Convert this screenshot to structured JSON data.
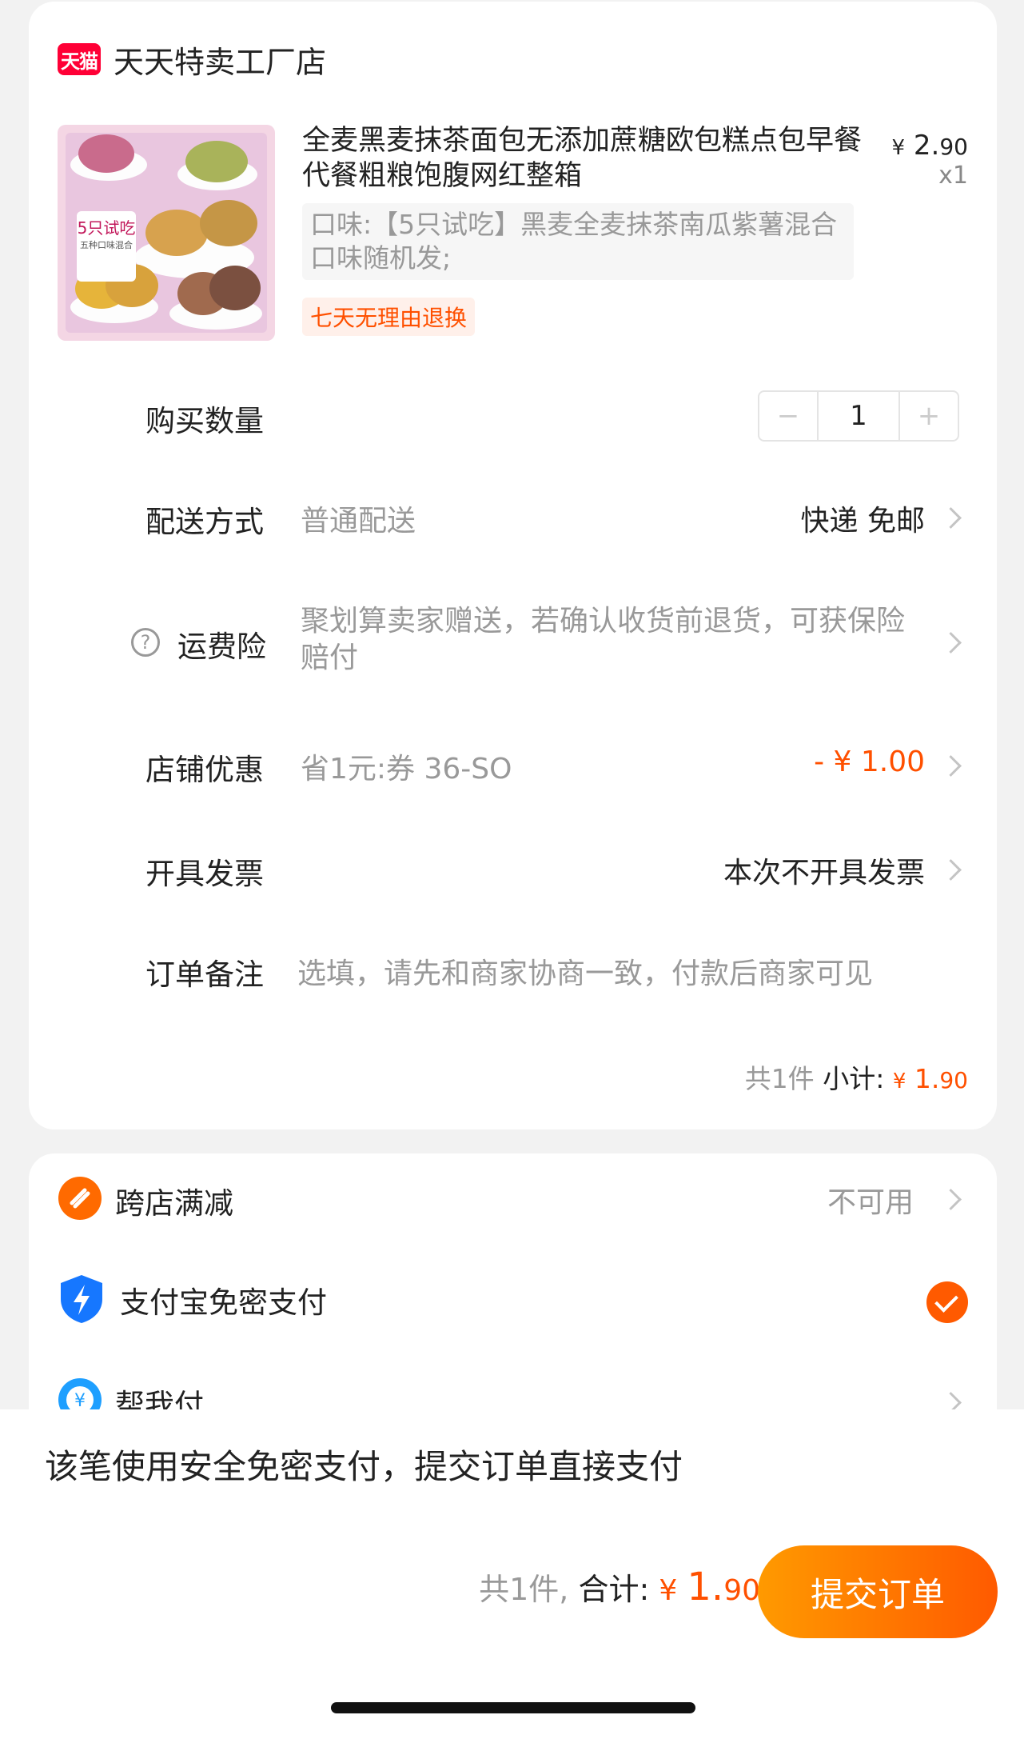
{
  "store": {
    "name": "天天特卖工厂店",
    "logo_text": "天猫"
  },
  "product": {
    "title": "全麦黑麦抹茶面包无添加蔗糖欧包糕点包早餐代餐粗粮饱腹网红整箱",
    "price_yen": "¥",
    "price_int": "2.",
    "price_dec": "90",
    "quantity_label": "x1",
    "flavor": "口味:【5只试吃】黑麦全麦抹茶南瓜紫薯混合口味随机发;",
    "badge": "七天无理由退换",
    "thumb_label": "5只试吃",
    "thumb_sub": "五种口味混合"
  },
  "rows": {
    "quantity": {
      "label": "购买数量",
      "value": "1",
      "minus": "−",
      "plus": "+"
    },
    "delivery": {
      "label": "配送方式",
      "sub": "普通配送",
      "value": "快递 免邮"
    },
    "insurance": {
      "label": "运费险",
      "icon": "?",
      "sub": "聚划算卖家赠送，若确认收货前退货，可获保险赔付"
    },
    "discount": {
      "label": "店铺优惠",
      "sub": "省1元:券 36-SO",
      "value": "- ¥ 1.00"
    },
    "invoice": {
      "label": "开具发票",
      "value": "本次不开具发票"
    },
    "note": {
      "label": "订单备注",
      "placeholder": "选填，请先和商家协商一致，付款后商家可见"
    }
  },
  "subtotal": {
    "count": "共1件",
    "label": "小计:",
    "yen": "¥",
    "int": "1.",
    "dec": "90"
  },
  "payment": {
    "cross_store": {
      "label": "跨店满减",
      "value": "不可用"
    },
    "alipay": {
      "label": "支付宝免密支付",
      "checked": true
    },
    "help_pay": {
      "label": "帮我付"
    }
  },
  "footer": {
    "notice": "该笔使用安全免密支付，提交订单直接支付",
    "count": "共1件,",
    "total_label": "合计:",
    "yen": "¥",
    "int": "1.",
    "dec": "90",
    "submit": "提交订单"
  },
  "colors": {
    "accent": "#ff5000",
    "tmall": "#ff0036",
    "alipay": "#1677ff"
  }
}
